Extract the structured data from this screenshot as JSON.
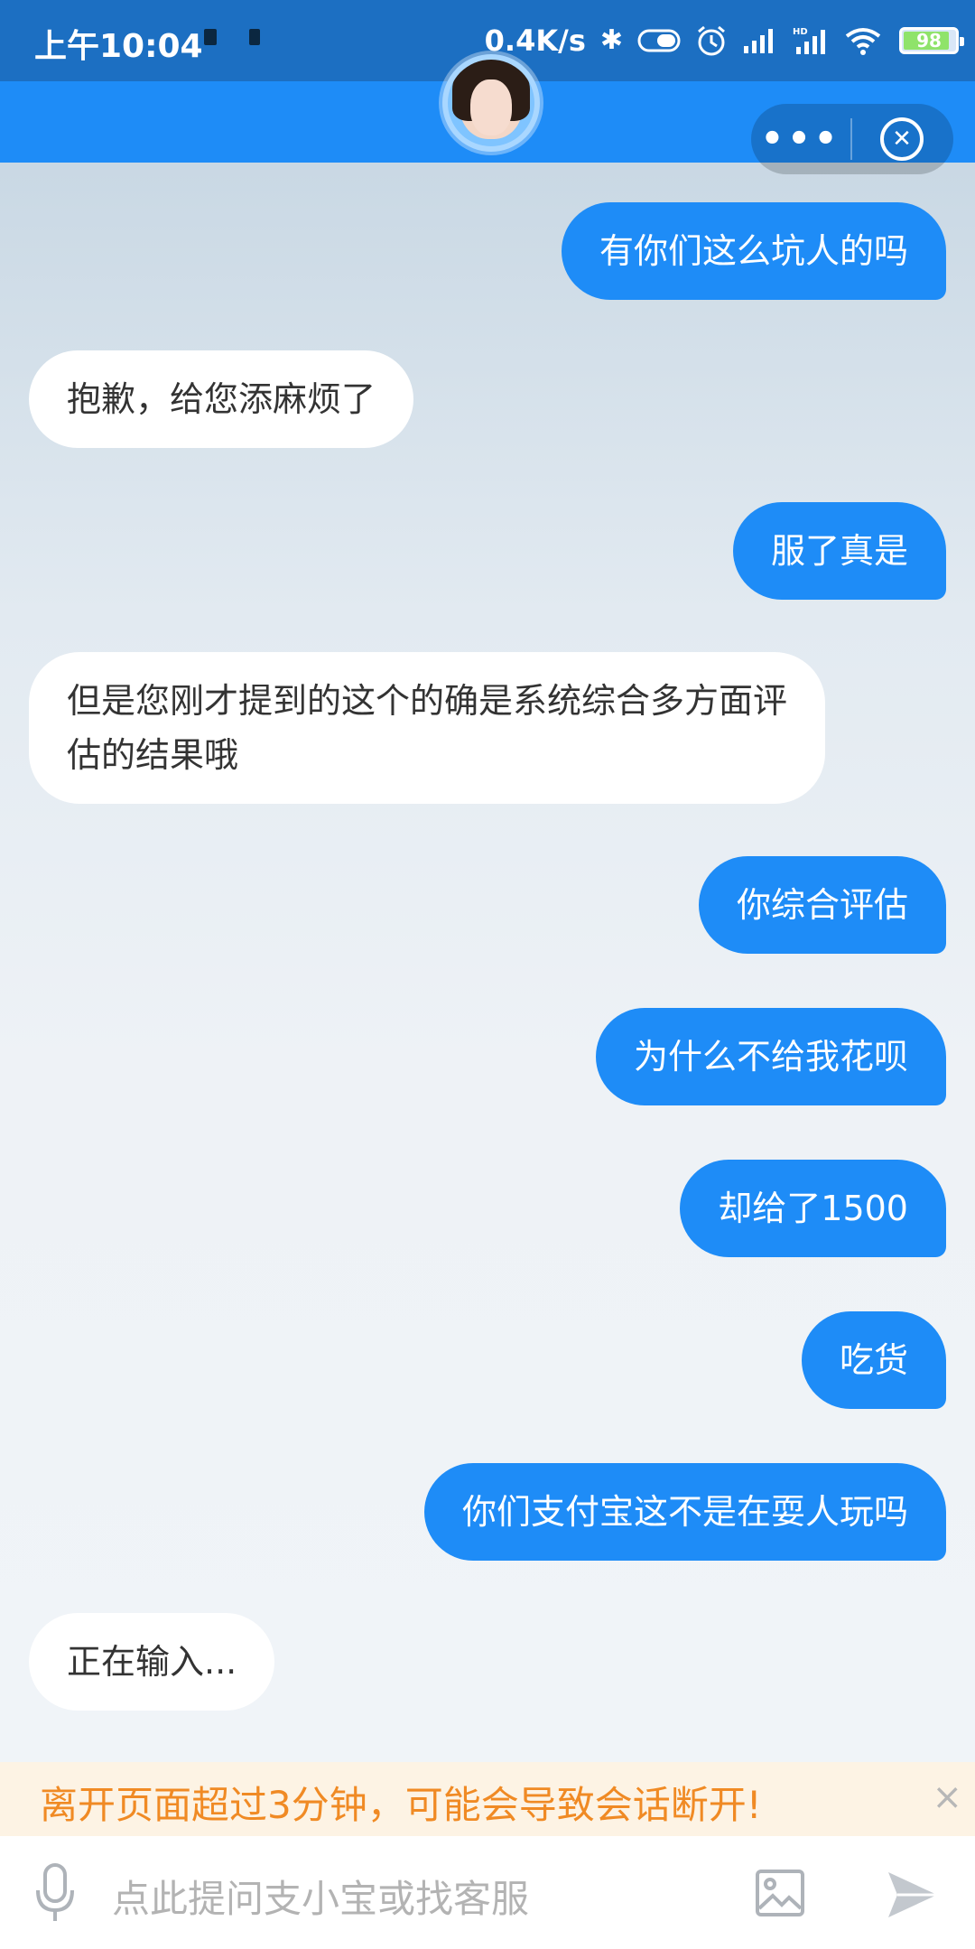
{
  "status_bar": {
    "time": "上午10:04",
    "net_speed": "0.4K/s",
    "battery_level": "98"
  },
  "header": {
    "more_label": "•••",
    "close_label": "✕"
  },
  "messages": [
    {
      "role": "user",
      "text": "有你们这么坑人的吗"
    },
    {
      "role": "bot",
      "text": "抱歉，给您添麻烦了"
    },
    {
      "role": "user",
      "text": "服了真是"
    },
    {
      "role": "bot",
      "text": "但是您刚才提到的这个的确是系统综合多方面评估的结果哦"
    },
    {
      "role": "user",
      "text": "你综合评估"
    },
    {
      "role": "user",
      "text": "为什么不给我花呗"
    },
    {
      "role": "user",
      "text": "却给了1500"
    },
    {
      "role": "user",
      "text": "吃货"
    },
    {
      "role": "user",
      "text": "你们支付宝这不是在耍人玩吗"
    },
    {
      "role": "bot",
      "text": "正在输入..."
    }
  ],
  "warning": {
    "text": "离开页面超过3分钟，可能会导致会话断开!",
    "close_label": "×"
  },
  "input": {
    "placeholder": "点此提问支小宝或找客服"
  },
  "colors": {
    "accent": "#1e8cf7",
    "status_bar": "#1c6fc2",
    "warning_text": "#f08a24",
    "warning_bg": "#fdf3e4"
  },
  "icons": [
    "bluetooth-icon",
    "alarm-icon",
    "signal-icon",
    "wifi-icon",
    "battery-icon",
    "mic-icon",
    "image-icon",
    "send-icon",
    "close-icon"
  ]
}
